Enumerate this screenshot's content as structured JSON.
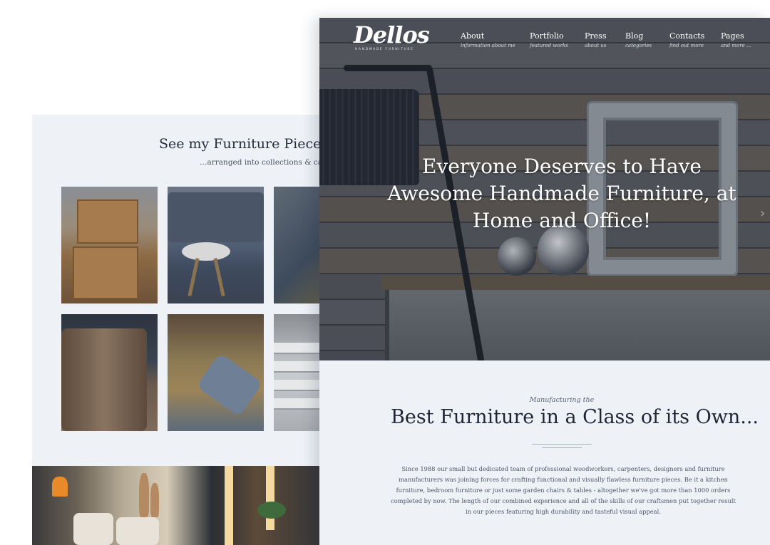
{
  "back_page": {
    "title": "See my Furniture Pieces in",
    "subtitle": "…arranged into collections & categ"
  },
  "front_page": {
    "logo": "Dellos",
    "logo_tagline": "HANDMADE FURNITURE",
    "nav": [
      {
        "label": "About",
        "sub": "information about me"
      },
      {
        "label": "Portfolio",
        "sub": "featured works"
      },
      {
        "label": "Press",
        "sub": "about us"
      },
      {
        "label": "Blog",
        "sub": "categories"
      },
      {
        "label": "Contacts",
        "sub": "find out more"
      },
      {
        "label": "Pages",
        "sub": "and more ..."
      }
    ],
    "hero_heading": [
      "Everyone Deserves to Have",
      "Awesome Handmade Furniture, at",
      "Home and Office!"
    ],
    "section": {
      "kicker": "Manufacturing the",
      "title": "Best Furniture in a Class of its Own...",
      "body": "Since 1988 our small but dedicated team of professional woodworkers, carpenters, designers and furniture manufacturers was joining forces for crafting functional and visually flawless furniture pieces. Be it a kitchen furniture, bedroom furniture or just some garden chairs & tables - altogether we've got more than 1000 orders completed by now. The length of our combined experience and all of the skills of our craftsmen put together result in our pieces featuring high durability and tasteful visual appeal."
    }
  },
  "colors": {
    "page_bg": "#eef2f7",
    "heading": "#1f2535",
    "body_text": "#4d5466",
    "hero_text": "#ffffff"
  },
  "icons": {
    "hero_arrow": "chevron-right-icon"
  }
}
